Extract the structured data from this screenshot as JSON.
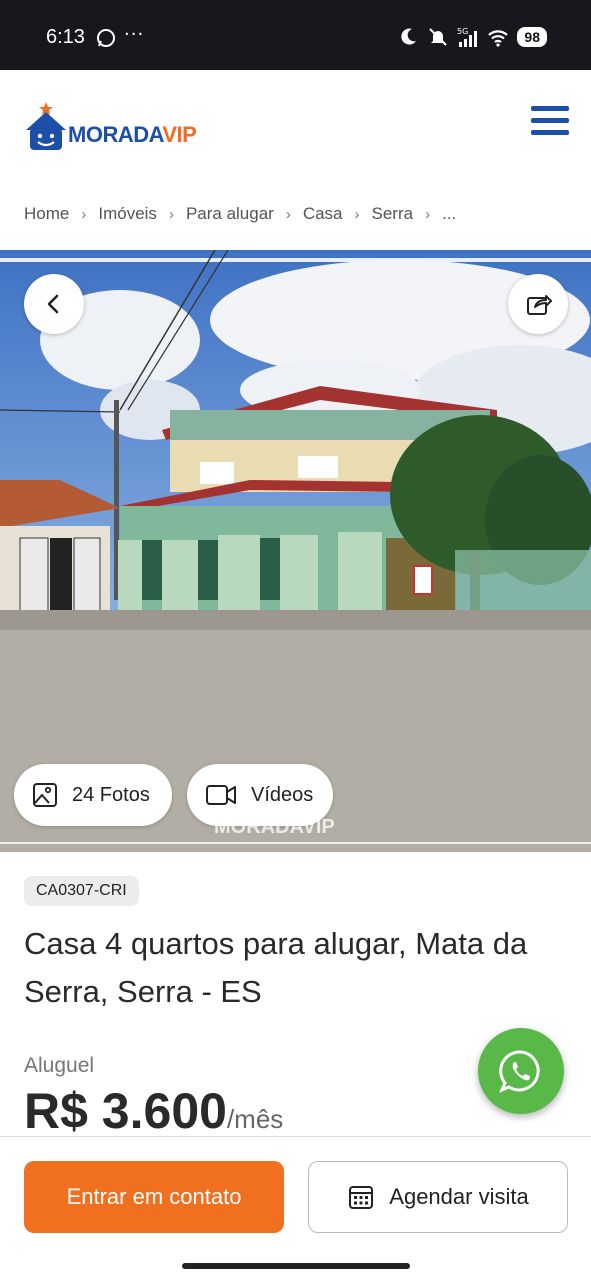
{
  "status_bar": {
    "time": "6:13",
    "dots": "···",
    "battery": "98",
    "network": "5G",
    "icons": [
      "whatsapp-icon",
      "moon-icon",
      "bell-off-icon",
      "signal-icon",
      "wifi-icon",
      "battery-icon"
    ]
  },
  "header": {
    "logo_part1": "MORADA",
    "logo_part2": "VIP",
    "menu_icon": "hamburger-icon"
  },
  "breadcrumb": {
    "items": [
      "Home",
      "Imóveis",
      "Para alugar",
      "Casa",
      "Serra",
      "..."
    ],
    "separator": "›"
  },
  "gallery": {
    "photos_label": "24 Fotos",
    "videos_label": "Vídeos",
    "watermark": "MORADAVIP"
  },
  "listing": {
    "code": "CA0307-CRI",
    "title": "Casa 4 quartos para alugar, Mata da Serra, Serra - ES",
    "rent_label": "Aluguel",
    "price": "R$ 3.600",
    "price_unit": "/mês"
  },
  "actions": {
    "contact_label": "Entrar em contato",
    "visit_label": "Agendar visita"
  },
  "colors": {
    "brand_blue": "#1d4fa8",
    "brand_orange": "#f07020",
    "whatsapp_green": "#58b848"
  }
}
